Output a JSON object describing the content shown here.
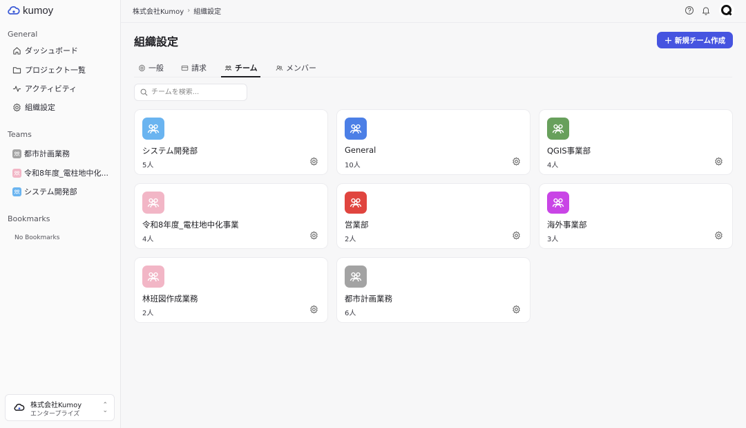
{
  "app": {
    "name": "kumoy",
    "accent": "#4654e0"
  },
  "breadcrumb": {
    "org": "株式会社Kumoy",
    "current": "組織設定"
  },
  "sidebar": {
    "general_title": "General",
    "nav": [
      {
        "label": "ダッシュボード",
        "icon": "home-icon"
      },
      {
        "label": "プロジェクト一覧",
        "icon": "folder-icon"
      },
      {
        "label": "アクティビティ",
        "icon": "activity-icon"
      },
      {
        "label": "組織設定",
        "icon": "gear-icon"
      }
    ],
    "teams_title": "Teams",
    "teams": [
      {
        "label": "都市計画業務",
        "color": "#a3a3a3"
      },
      {
        "label": "令和8年度_電柱地中化...",
        "color": "#f2b6c6"
      },
      {
        "label": "システム開発部",
        "color": "#6ab4f0"
      }
    ],
    "bookmarks_title": "Bookmarks",
    "bookmarks_empty": "No Bookmarks"
  },
  "org_switcher": {
    "name": "株式会社Kumoy",
    "plan": "エンタープライズ"
  },
  "header": {
    "title": "組織設定",
    "new_button": "新規チーム作成"
  },
  "tabs": [
    {
      "label": "一般",
      "icon": "gear-icon"
    },
    {
      "label": "請求",
      "icon": "credit-card-icon"
    },
    {
      "label": "チーム",
      "icon": "users-icon",
      "active": true
    },
    {
      "label": "メンバー",
      "icon": "user-icon"
    }
  ],
  "search": {
    "placeholder": "チームを検索..."
  },
  "cards": [
    {
      "name": "システム開発部",
      "count": "5人",
      "color": "#6ab4f0"
    },
    {
      "name": "General",
      "count": "10人",
      "color": "#4c7fe6"
    },
    {
      "name": "QGIS事業部",
      "count": "4人",
      "color": "#68a05c"
    },
    {
      "name": "令和8年度_電柱地中化事業",
      "count": "4人",
      "color": "#f2b6c6"
    },
    {
      "name": "営業部",
      "count": "2人",
      "color": "#e0453f"
    },
    {
      "name": "海外事業部",
      "count": "3人",
      "color": "#c945e6"
    },
    {
      "name": "林班図作成業務",
      "count": "2人",
      "color": "#f2b6c6"
    },
    {
      "name": "都市計画業務",
      "count": "6人",
      "color": "#a3a3a3"
    }
  ]
}
